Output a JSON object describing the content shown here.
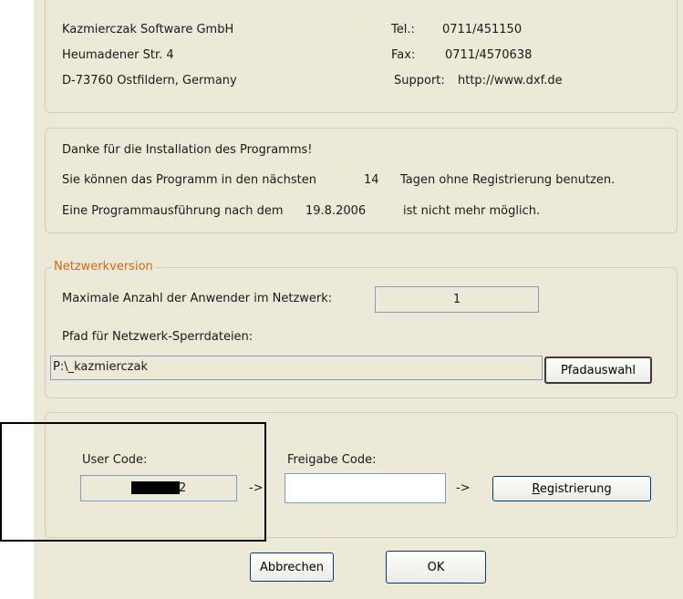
{
  "company": {
    "name": "Kazmierczak Software GmbH",
    "street": "Heumadener Str. 4",
    "city": "D-73760 Ostfildern, Germany",
    "tel_label": "Tel.:",
    "tel": "0711/451150",
    "fax_label": "Fax:",
    "fax": "0711/4570638",
    "support_label": "Support:",
    "support": "http://www.dxf.de"
  },
  "trial": {
    "line1": "Danke für die Installation des Programms!",
    "line2_prefix": "Sie können das Programm in den nächsten",
    "days": "14",
    "line2_suffix": "Tagen ohne Registrierung benutzen.",
    "line3_prefix": "Eine Programmausführung nach dem",
    "date": "19.8.2006",
    "line3_suffix": "ist nicht mehr möglich."
  },
  "network": {
    "legend": "Netzwerkversion",
    "max_users_label": "Maximale Anzahl der Anwender im Netzwerk:",
    "max_users_value": "1",
    "path_label": "Pfad für Netzwerk-Sperrdateien:",
    "path_value": "P:\\_kazmierczak",
    "path_button": "Pfadauswahl"
  },
  "registration": {
    "user_code_label": "User Code:",
    "user_code_visible": "2",
    "arrow1": "->",
    "release_code_label": "Freigabe Code:",
    "release_code_value": "",
    "arrow2": "->",
    "register_button": "Registrierung"
  },
  "footer": {
    "cancel_button": "Abbrechen",
    "ok_button": "OK"
  }
}
